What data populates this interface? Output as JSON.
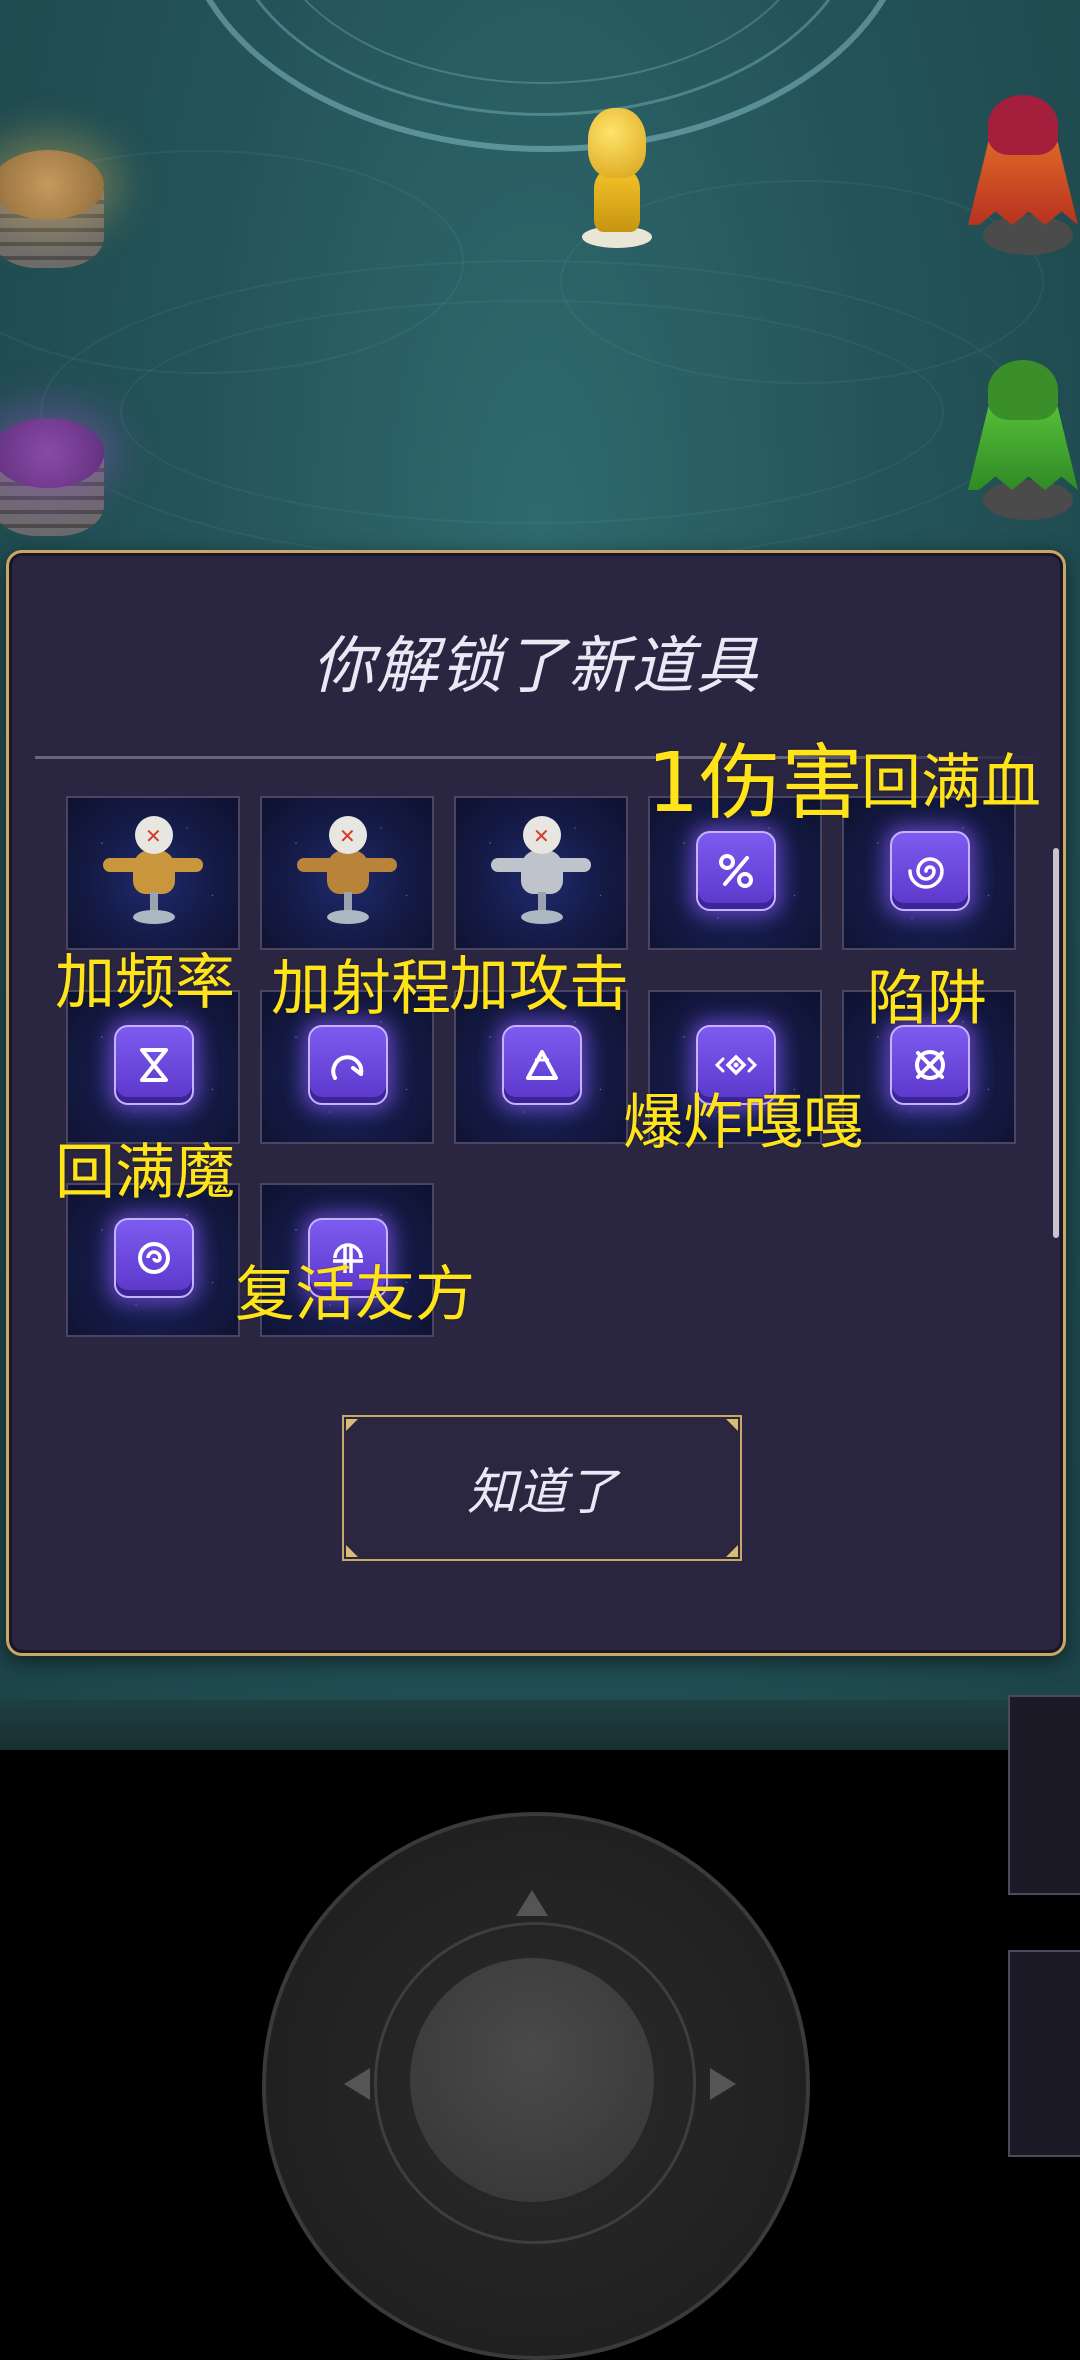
{
  "dialog": {
    "title": "你解锁了新道具",
    "ok_label": "知道了"
  },
  "items": [
    {
      "kind": "dummy",
      "color": "#c9963c",
      "icon": "training-dummy-icon"
    },
    {
      "kind": "dummy",
      "color": "#b9843a",
      "icon": "training-dummy-icon"
    },
    {
      "kind": "dummy",
      "color": "#bfc4cc",
      "icon": "training-dummy-icon"
    },
    {
      "kind": "rune",
      "icon": "percent-rune-icon"
    },
    {
      "kind": "rune",
      "icon": "spiral-rune-icon"
    },
    {
      "kind": "rune",
      "icon": "hourglass-rune-icon"
    },
    {
      "kind": "rune",
      "icon": "arc-rune-icon"
    },
    {
      "kind": "rune",
      "icon": "triangle-rune-icon"
    },
    {
      "kind": "rune",
      "icon": "diamond-rune-icon"
    },
    {
      "kind": "rune",
      "icon": "crossed-circle-rune-icon"
    },
    {
      "kind": "rune",
      "icon": "swirl-rune-icon"
    },
    {
      "kind": "rune",
      "icon": "sigil-rune-icon"
    }
  ],
  "labels": {
    "damage": "1伤害",
    "full_hp": "回满血",
    "frequency": "加频率",
    "range": "加射程",
    "attack": "加攻击",
    "trap": "陷阱",
    "explode": "爆炸嘎嘎",
    "full_mana": "回满魔",
    "revive": "复活友方"
  },
  "colors": {
    "label": "#ffe419",
    "dialog_bg": "#2a2540",
    "dialog_border": "#c9a866",
    "board": "#245459"
  }
}
